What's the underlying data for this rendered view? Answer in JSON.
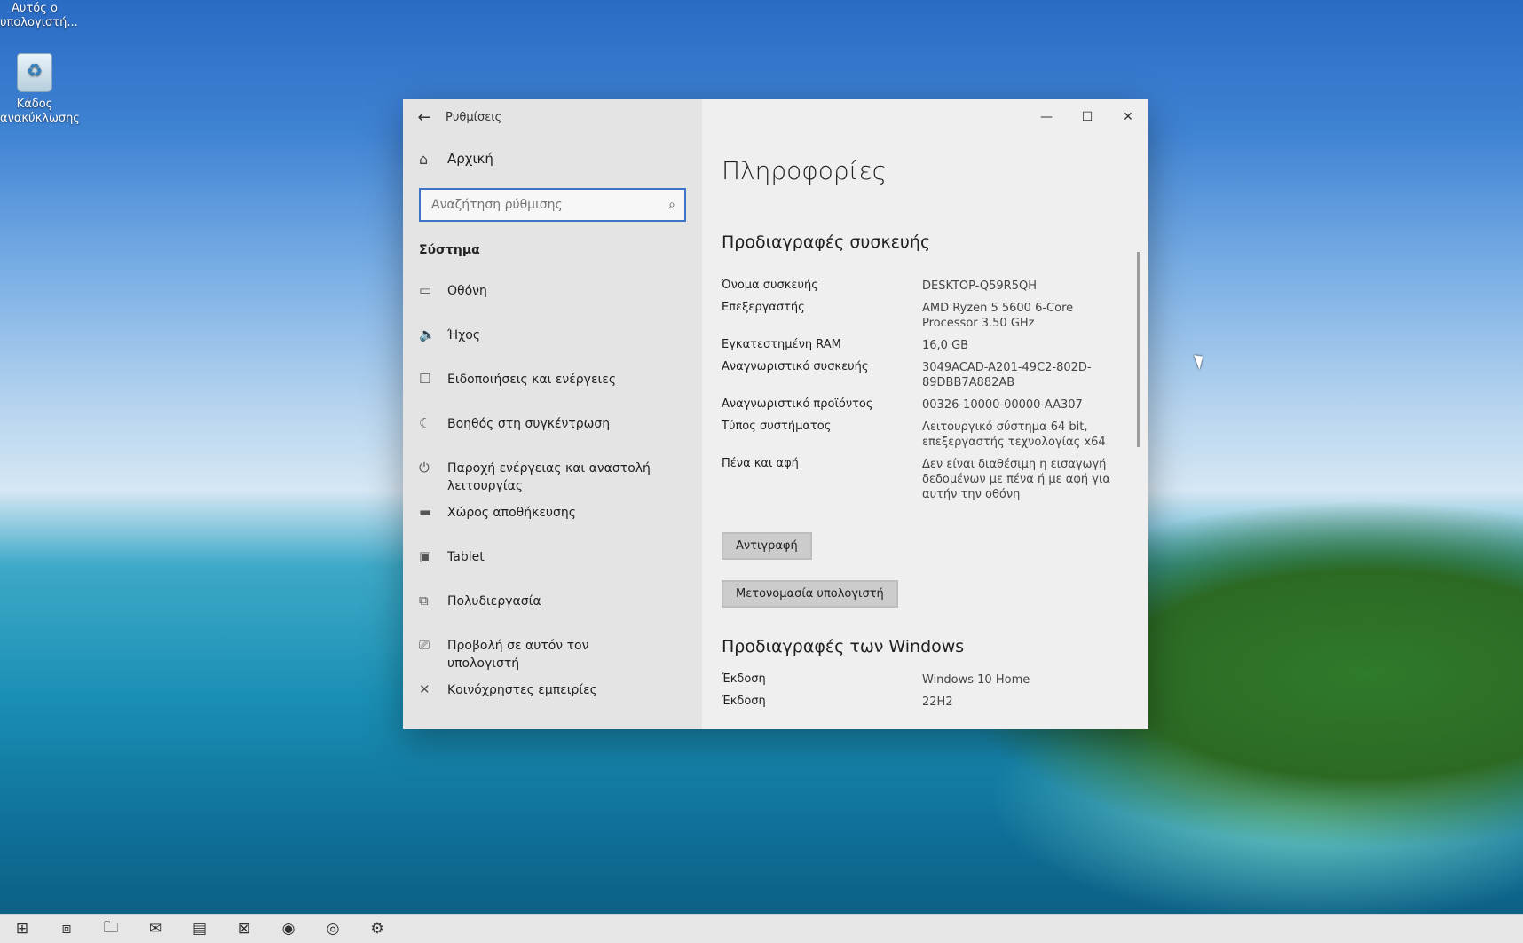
{
  "desktop": {
    "this_pc_label": "Αυτός ο υπολογιστή...",
    "recycle_bin_label": "Κάδος ανακύκλωσης"
  },
  "window": {
    "title": "Ρυθμίσεις",
    "controls": {
      "minimize": "—",
      "maximize": "☐",
      "close": "✕"
    }
  },
  "sidebar": {
    "home_label": "Αρχική",
    "search_placeholder": "Αναζήτηση ρύθμισης",
    "section_title": "Σύστημα",
    "items": [
      {
        "label": "Οθόνη",
        "icon": "display-icon",
        "glyph": "▭"
      },
      {
        "label": "Ήχος",
        "icon": "speaker-icon",
        "glyph": "🔈"
      },
      {
        "label": "Ειδοποιήσεις και ενέργειες",
        "icon": "notification-icon",
        "glyph": "☐"
      },
      {
        "label": "Βοηθός στη συγκέντρωση",
        "icon": "moon-icon",
        "glyph": "☾"
      },
      {
        "label": "Παροχή ενέργειας και αναστολή λειτουργίας",
        "icon": "power-icon",
        "glyph": "⏻"
      },
      {
        "label": "Χώρος αποθήκευσης",
        "icon": "storage-icon",
        "glyph": "▬"
      },
      {
        "label": "Tablet",
        "icon": "tablet-icon",
        "glyph": "▣"
      },
      {
        "label": "Πολυδιεργασία",
        "icon": "multitasking-icon",
        "glyph": "⧉"
      },
      {
        "label": "Προβολή σε αυτόν τον υπολογιστή",
        "icon": "project-icon",
        "glyph": "⎚"
      },
      {
        "label": "Κοινόχρηστες εμπειρίες",
        "icon": "shared-experiences-icon",
        "glyph": "✕"
      }
    ]
  },
  "content": {
    "page_title": "Πληροφορίες",
    "device_specs_title": "Προδιαγραφές συσκευής",
    "device_specs": [
      {
        "label": "Όνομα συσκευής",
        "value": "DESKTOP-Q59R5QH"
      },
      {
        "label": "Επεξεργαστής",
        "value": "AMD Ryzen 5 5600 6-Core Processor 3.50 GHz"
      },
      {
        "label": "Εγκατεστημένη RAM",
        "value": "16,0 GB"
      },
      {
        "label": "Αναγνωριστικό συσκευής",
        "value": "3049ACAD-A201-49C2-802D-89DBB7A882AB"
      },
      {
        "label": "Αναγνωριστικό προϊόντος",
        "value": "00326-10000-00000-AA307"
      },
      {
        "label": "Τύπος συστήματος",
        "value": "Λειτουργικό σύστημα 64 bit, επεξεργαστής τεχνολογίας x64"
      },
      {
        "label": "Πένα και αφή",
        "value": "Δεν είναι διαθέσιμη η εισαγωγή δεδομένων με πένα ή με αφή για αυτήν την οθόνη"
      }
    ],
    "copy_button": "Αντιγραφή",
    "rename_button": "Μετονομασία υπολογιστή",
    "windows_specs_title": "Προδιαγραφές των Windows",
    "windows_specs": [
      {
        "label": "Έκδοση",
        "value": "Windows 10 Home"
      },
      {
        "label": "Έκδοση",
        "value": "22H2"
      }
    ]
  },
  "taskbar": {
    "icons": [
      {
        "name": "start-icon",
        "glyph": "⊞"
      },
      {
        "name": "task-view-icon",
        "glyph": "⧈"
      },
      {
        "name": "file-explorer-icon",
        "glyph": "🗀"
      },
      {
        "name": "mail-icon",
        "glyph": "✉"
      },
      {
        "name": "app-icon",
        "glyph": "▤"
      },
      {
        "name": "excel-icon",
        "glyph": "⊠"
      },
      {
        "name": "firefox-icon",
        "glyph": "◉"
      },
      {
        "name": "chrome-icon",
        "glyph": "◎"
      },
      {
        "name": "settings-icon",
        "glyph": "⚙"
      }
    ]
  }
}
